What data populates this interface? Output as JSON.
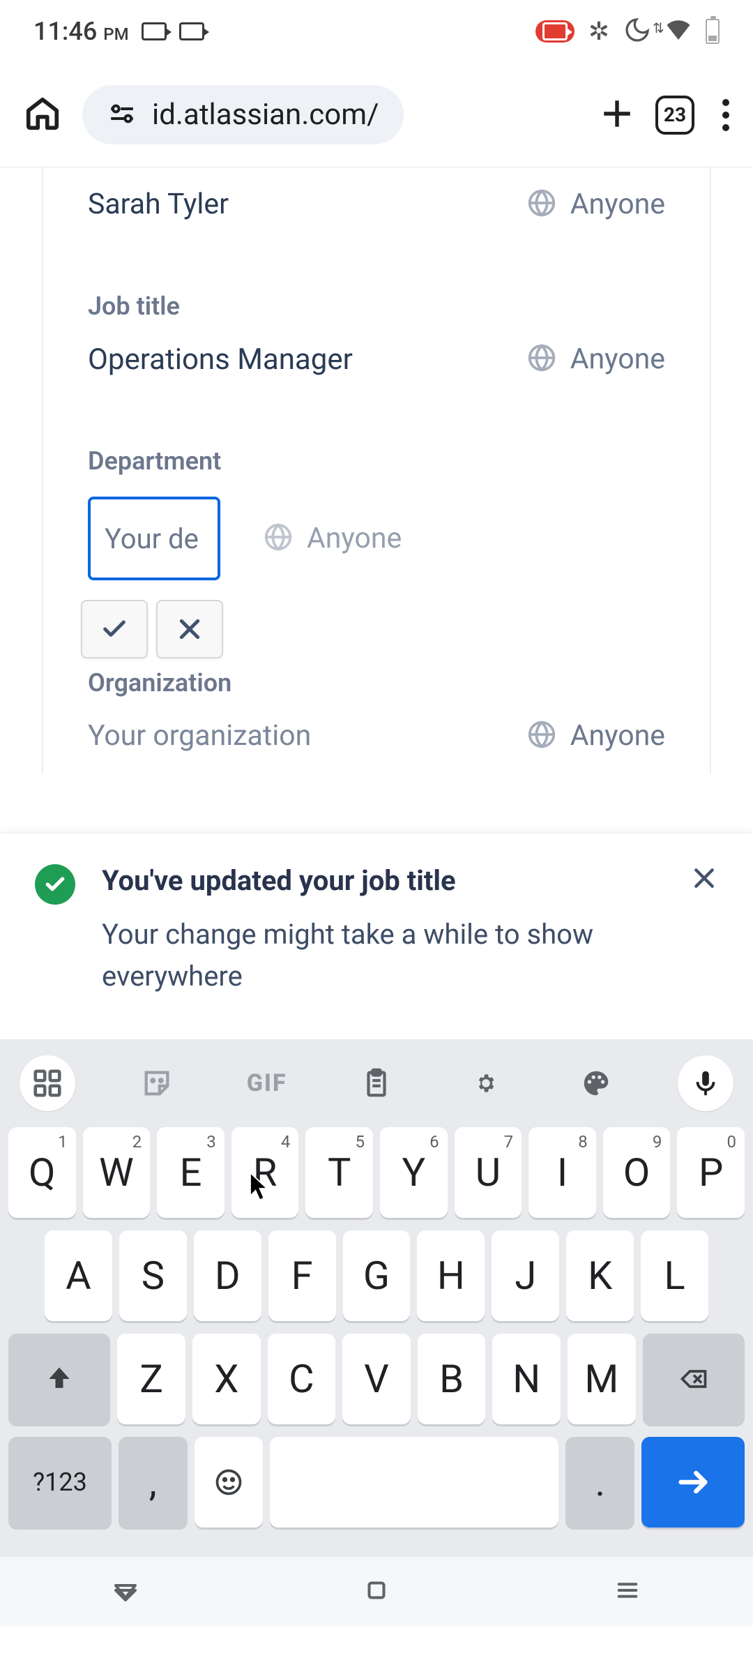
{
  "status": {
    "time": "11:46",
    "ampm": "PM"
  },
  "browser": {
    "url": "id.atlassian.com/",
    "tab_count": "23"
  },
  "profile": {
    "name": "Sarah Tyler",
    "name_visibility": "Anyone",
    "job_label": "Job title",
    "job_value": "Operations Manager",
    "job_visibility": "Anyone",
    "dept_label": "Department",
    "dept_placeholder": "Your de",
    "dept_visibility": "Anyone",
    "org_label": "Organization",
    "org_value": "Your organization",
    "org_visibility": "Anyone"
  },
  "toast": {
    "title": "You've updated your job title",
    "msg": "Your change might take a while to show everywhere"
  },
  "keyboard": {
    "gif": "GIF",
    "row1": [
      {
        "k": "Q",
        "s": "1"
      },
      {
        "k": "W",
        "s": "2"
      },
      {
        "k": "E",
        "s": "3"
      },
      {
        "k": "R",
        "s": "4"
      },
      {
        "k": "T",
        "s": "5"
      },
      {
        "k": "Y",
        "s": "6"
      },
      {
        "k": "U",
        "s": "7"
      },
      {
        "k": "I",
        "s": "8"
      },
      {
        "k": "O",
        "s": "9"
      },
      {
        "k": "P",
        "s": "0"
      }
    ],
    "row2": [
      "A",
      "S",
      "D",
      "F",
      "G",
      "H",
      "J",
      "K",
      "L"
    ],
    "row3": [
      "Z",
      "X",
      "C",
      "V",
      "B",
      "N",
      "M"
    ],
    "nums": "?123",
    "comma": ",",
    "period": "."
  }
}
